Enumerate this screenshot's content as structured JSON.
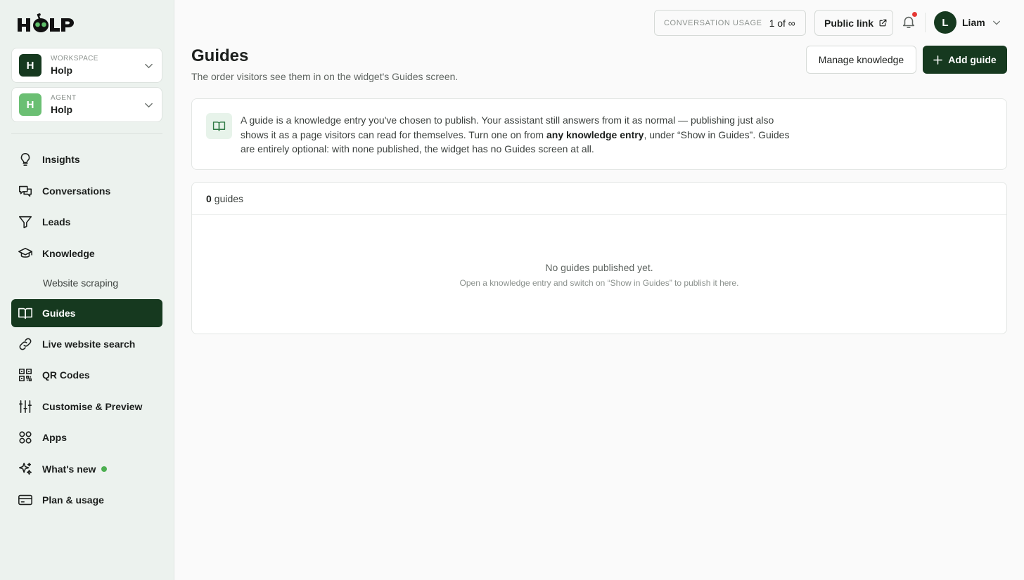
{
  "brand": {
    "logo_text": "HOLP",
    "accent": "#16391f",
    "accent_light": "#6bbf73",
    "sidebar_bg": "#ecf2ee"
  },
  "workspace": {
    "label": "WORKSPACE",
    "value": "Holp",
    "initial": "H"
  },
  "agent": {
    "label": "AGENT",
    "value": "Holp",
    "initial": "H"
  },
  "nav": {
    "insights": "Insights",
    "conversations": "Conversations",
    "leads": "Leads",
    "knowledge": "Knowledge",
    "website_scraping": "Website scraping",
    "guides": "Guides",
    "live_search": "Live website search",
    "qr_codes": "QR Codes",
    "customise": "Customise & Preview",
    "apps": "Apps",
    "whats_new": "What's new",
    "plan": "Plan & usage"
  },
  "topbar": {
    "usage_label": "CONVERSATION USAGE",
    "usage_value": "1 of ∞",
    "public_link": "Public link",
    "user_initial": "L",
    "user_name": "Liam"
  },
  "page": {
    "title": "Guides",
    "subtitle": "The order visitors see them in on the widget's Guides screen.",
    "manage_button": "Manage knowledge",
    "add_button": "Add guide"
  },
  "info": {
    "text_before": "A guide is a knowledge entry you've chosen to publish. Your assistant still answers from it as normal — publishing just also shows it as a page visitors can read for themselves. Turn one on from ",
    "text_bold": "any knowledge entry",
    "text_after": ", under “Show in Guides”. Guides are entirely optional: with none published, the widget has no Guides screen at all."
  },
  "list": {
    "count": "0",
    "count_label": "guides",
    "empty_title": "No guides published yet.",
    "empty_subtitle": "Open a knowledge entry and switch on “Show in Guides” to publish it here."
  }
}
